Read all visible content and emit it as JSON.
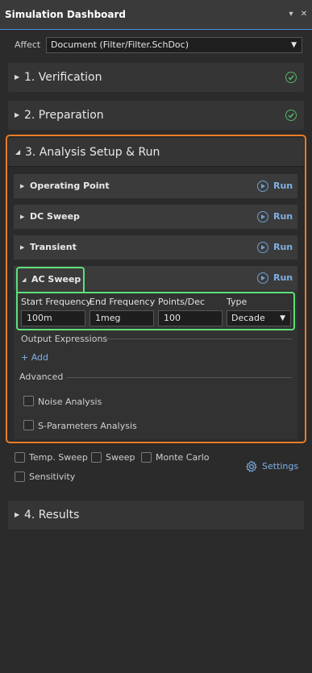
{
  "window": {
    "title": "Simulation Dashboard",
    "pin_glyph": "▾",
    "close_glyph": "✕"
  },
  "affect": {
    "label": "Affect",
    "value": "Document (Filter/Filter.SchDoc)"
  },
  "sections": {
    "verification": {
      "label": "1. Verification",
      "status": "complete",
      "icon": "check-circle-icon"
    },
    "preparation": {
      "label": "2. Preparation",
      "status": "complete",
      "icon": "check-circle-icon"
    },
    "analysis": {
      "label": "3. Analysis Setup & Run",
      "expanded": true
    },
    "results": {
      "label": "4. Results"
    }
  },
  "analyses": {
    "operating_point": {
      "label": "Operating Point",
      "run_label": "Run"
    },
    "dc_sweep": {
      "label": "DC Sweep",
      "run_label": "Run"
    },
    "transient": {
      "label": "Transient",
      "run_label": "Run"
    },
    "ac_sweep": {
      "label": "AC Sweep",
      "run_label": "Run",
      "expanded": true
    }
  },
  "ac_sweep_fields": {
    "start_frequency": {
      "label": "Start Frequency",
      "value": "100m"
    },
    "end_frequency": {
      "label": "End Frequency",
      "value": "1meg"
    },
    "points_per_dec": {
      "label": "Points/Dec",
      "value": "100"
    },
    "type": {
      "label": "Type",
      "value": "Decade"
    }
  },
  "output_expressions": {
    "label": "Output Expressions",
    "add_label": "+ Add"
  },
  "advanced": {
    "label": "Advanced",
    "options": [
      {
        "label": "Noise Analysis",
        "checked": false
      },
      {
        "label": "S-Parameters Analysis",
        "checked": false
      }
    ]
  },
  "bottom_options": [
    {
      "label": "Temp. Sweep",
      "checked": false
    },
    {
      "label": "Sweep",
      "checked": false
    },
    {
      "label": "Monte Carlo",
      "checked": false
    },
    {
      "label": "Sensitivity",
      "checked": false
    }
  ],
  "settings": {
    "label": "Settings"
  },
  "colors": {
    "highlight_orange": "#ea7c27",
    "highlight_green": "#5ce07a",
    "check_green": "#55b36a",
    "link_blue": "#7fb0e6",
    "panel_bg": "#2b2b2b"
  },
  "icons": {
    "collapsed": "triangle-right-icon",
    "expanded": "triangle-down-icon",
    "run": "play-circle-icon",
    "settings": "gear-icon",
    "dropdown": "chevron-down-icon"
  }
}
